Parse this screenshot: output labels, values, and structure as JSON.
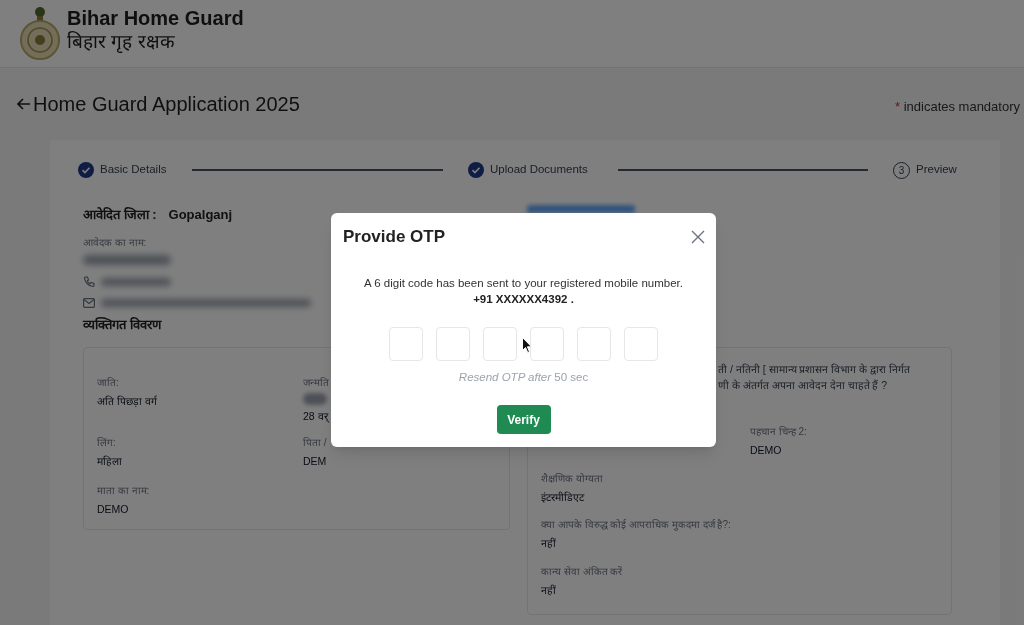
{
  "header": {
    "title": "Bihar Home Guard",
    "subtitle": "बिहार गृह रक्षक"
  },
  "page_heading": {
    "title": "Home Guard Application 2025",
    "mandatory_note": {
      "marker": "*",
      "text": "indicates mandatory"
    }
  },
  "stepper": [
    {
      "label": "Basic Details",
      "done": true
    },
    {
      "label": "Upload Documents",
      "done": true
    },
    {
      "label": "Preview",
      "done": false,
      "number": "3"
    }
  ],
  "applicant": {
    "district_label": "आवेदित जिला :",
    "district": "Gopalganj",
    "name_label": "आवेदक का नाम:"
  },
  "personal_details": {
    "heading": "व्यक्तिगत विवरण",
    "left_card": [
      [
        {
          "label": "जाति:",
          "blurred": false,
          "value": "अति पिछड़ा वर्ग"
        },
        {
          "label": "जन्मति",
          "blurred": true,
          "value": "28 वर्"
        }
      ],
      [
        {
          "label": "लिंग:",
          "blurred": false,
          "value": "महिला"
        },
        {
          "label": "पिता /",
          "blurred": false,
          "value": "DEM"
        }
      ],
      [
        {
          "label": "माता का नाम:",
          "blurred": false,
          "value": "DEMO"
        }
      ]
    ],
    "right_card": {
      "question_lines": [
        "ती / नतिनी [ सामान्य प्रशासन विभाग के द्वारा निर्गत",
        "णी के अंतर्गत अपना आवेदन देना चाहते हैं ?"
      ],
      "identification_mark": {
        "label": "पहचान चिन्ह 2:",
        "value": "DEMO"
      },
      "fields": [
        {
          "label": "शैक्षणिक योग्यता",
          "value": "इंटरमीडिएट"
        },
        {
          "label": "क्या आपके विरुद्ध कोई आपराधिक मुकदमा दर्ज है?:",
          "value": "नहीं"
        },
        {
          "label": "कान्य सेवा अंकित करें",
          "value": "नहीं"
        }
      ]
    }
  },
  "otp_dialog": {
    "title": "Provide OTP",
    "message": "A 6 digit code has been sent to your registered mobile number.",
    "phone": "+91 XXXXXX4392 .",
    "otp_fields": [
      {
        "focused": false
      },
      {
        "focused": false
      },
      {
        "focused": false
      },
      {
        "focused": false
      },
      {
        "focused": false
      },
      {
        "focused": false
      }
    ],
    "resend": "*Resend OTP after* 50 sec",
    "button": "Verify"
  }
}
